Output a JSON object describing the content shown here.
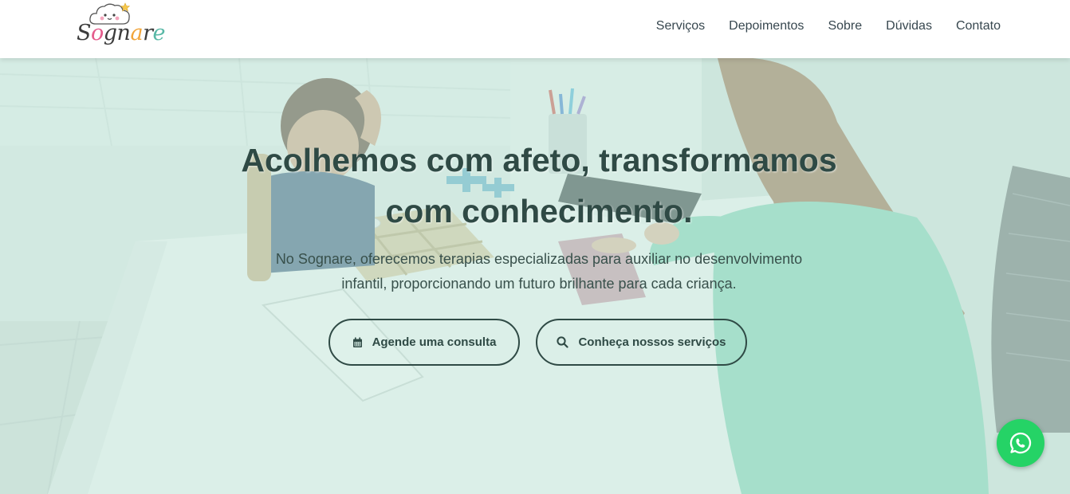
{
  "brand": {
    "logo_text": "Sognare",
    "logo_parts": [
      "S",
      "o",
      "gn",
      "a",
      "r",
      "e"
    ]
  },
  "nav": {
    "items": [
      {
        "label": "Serviços"
      },
      {
        "label": "Depoimentos"
      },
      {
        "label": "Sobre"
      },
      {
        "label": "Dúvidas"
      },
      {
        "label": "Contato"
      }
    ]
  },
  "hero": {
    "title_line1": "Acolhemos com afeto, transformamos",
    "title_line2": "com conhecimento.",
    "subtitle_line1": "No Sognare, oferecemos terapias especializadas para auxiliar no desenvolvimento",
    "subtitle_line2": "infantil, proporcionando um futuro brilhante para cada criança.",
    "primary_button": {
      "label": "Agende uma consulta",
      "icon": "calendar-icon"
    },
    "secondary_button": {
      "label": "Conheça nossos serviços",
      "icon": "search-icon"
    }
  },
  "floating": {
    "whatsapp_icon": "whatsapp-icon"
  },
  "colors": {
    "text_dark": "#2f4a45",
    "nav_text": "#37474f",
    "overlay": "#c6eadc",
    "whatsapp": "#25d366"
  }
}
